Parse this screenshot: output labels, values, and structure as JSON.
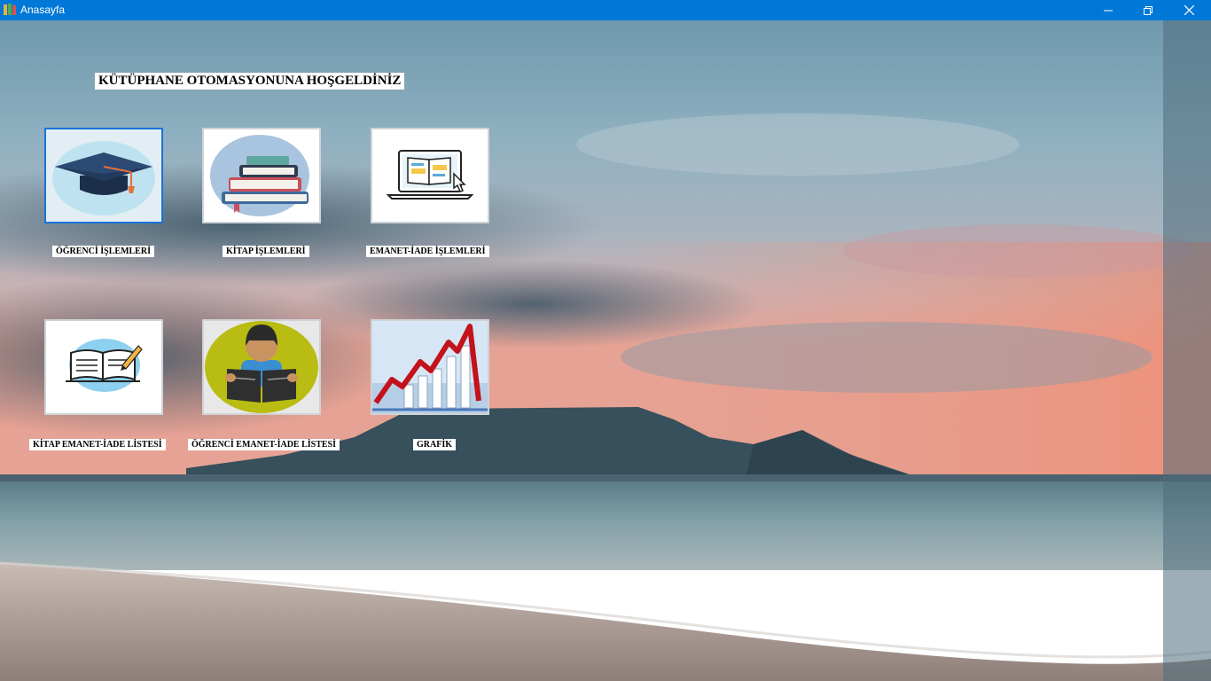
{
  "window": {
    "title": "Anasayfa",
    "accent_color": "#0078d7",
    "controls": [
      "minimize-icon",
      "restore-icon",
      "close-icon"
    ]
  },
  "main": {
    "heading": "KÜTÜPHANE OTOMASYONUNA HOŞGELDİNİZ",
    "tiles": [
      {
        "label": "ÖĞRENCİ İŞLEMLERİ",
        "icon": "graduation-cap-icon",
        "selected": true
      },
      {
        "label": "KİTAP İŞLEMLERİ",
        "icon": "book-stack-icon",
        "selected": false
      },
      {
        "label": "EMANET-İADE İŞLEMLERİ",
        "icon": "laptop-ebook-icon",
        "selected": false
      },
      {
        "label": "KİTAP EMANET-İADE LİSTESİ",
        "icon": "open-book-pencil-icon",
        "selected": false
      },
      {
        "label": "ÖĞRENCİ EMANET-İADE  LİSTESİ",
        "icon": "student-reading-icon",
        "selected": false
      },
      {
        "label": "GRAFİK",
        "icon": "growth-chart-icon",
        "selected": false
      }
    ]
  }
}
